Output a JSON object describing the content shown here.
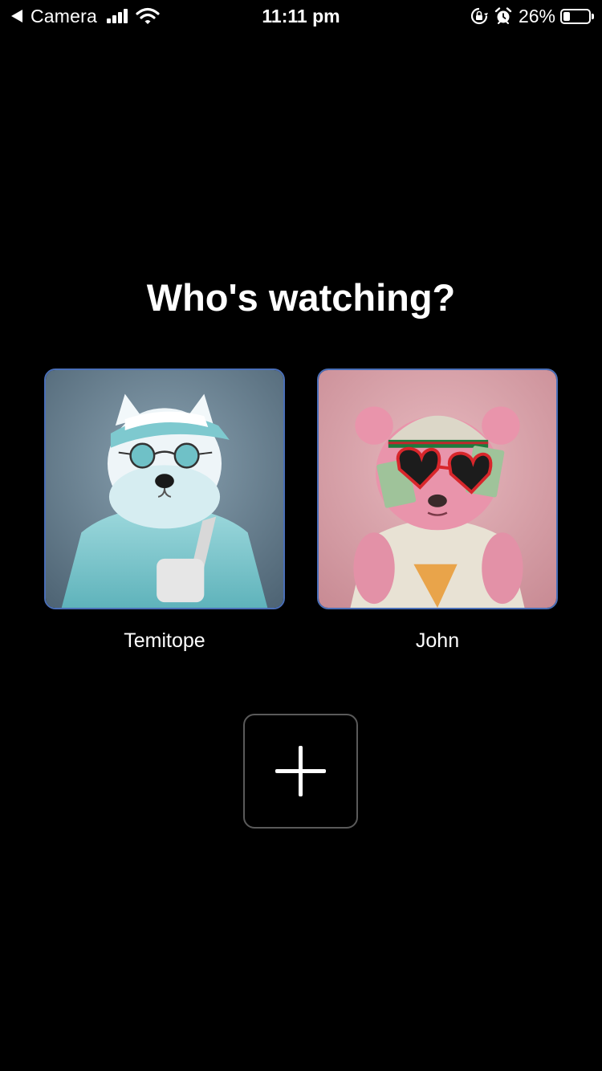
{
  "status_bar": {
    "back_label": "Camera",
    "time": "11:11 pm",
    "battery_percent_label": "26%",
    "battery_level": 0.26,
    "icons": [
      "back-arrow-icon",
      "cellular-signal-icon",
      "wifi-icon",
      "orientation-lock-icon",
      "alarm-icon",
      "battery-icon"
    ]
  },
  "main": {
    "title": "Who's watching?",
    "profiles": [
      {
        "name": "Temitope",
        "avatar": "white-bear-with-blue-cap-and-round-sunglasses"
      },
      {
        "name": "John",
        "avatar": "pink-bear-with-heart-sunglasses-and-money"
      }
    ],
    "add_profile_icon": "plus-icon"
  },
  "colors": {
    "background": "#000000",
    "text": "#ffffff",
    "avatar_border": "#4a6fb8",
    "add_button_border": "#5a5a5a",
    "profile1_background": "#6d8696",
    "profile2_background": "#d9a3ab"
  }
}
